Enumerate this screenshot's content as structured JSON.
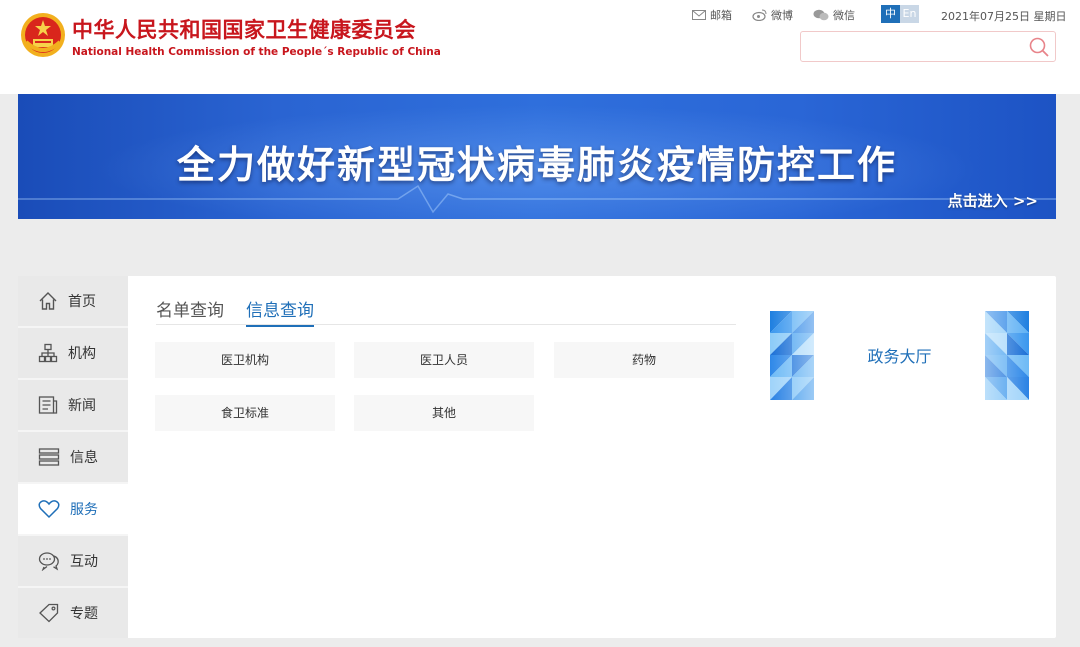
{
  "header": {
    "title_cn": "中华人民共和国国家卫生健康委员会",
    "title_en": "National Health Commission of the People´s Republic of China",
    "emblem_icon": "national-emblem-icon",
    "links": [
      {
        "label": "邮箱",
        "icon": "mail-icon"
      },
      {
        "label": "微博",
        "icon": "weibo-icon"
      },
      {
        "label": "微信",
        "icon": "wechat-icon"
      }
    ],
    "lang_cn": "中",
    "lang_en": "En",
    "date": "2021年07月25日 星期日",
    "search_placeholder": ""
  },
  "banner": {
    "text": "全力做好新型冠状病毒肺炎疫情防控工作",
    "enter": "点击进入 >>"
  },
  "sidenav": {
    "items": [
      {
        "label": "首页",
        "icon": "home-icon"
      },
      {
        "label": "机构",
        "icon": "org-chart-icon"
      },
      {
        "label": "新闻",
        "icon": "news-icon"
      },
      {
        "label": "信息",
        "icon": "info-stack-icon"
      },
      {
        "label": "服务",
        "icon": "heart-icon",
        "active": true
      },
      {
        "label": "互动",
        "icon": "chat-icon"
      },
      {
        "label": "专题",
        "icon": "tag-icon"
      }
    ]
  },
  "main": {
    "tabs": [
      {
        "label": "名单查询"
      },
      {
        "label": "信息查询",
        "active": true
      }
    ],
    "buttons": [
      "医卫机构",
      "医卫人员",
      "药物",
      "食卫标准",
      "其他"
    ],
    "hall_label": "政务大厅"
  },
  "colors": {
    "brand_red": "#c8161d",
    "accent_blue": "#1f6fb8"
  }
}
